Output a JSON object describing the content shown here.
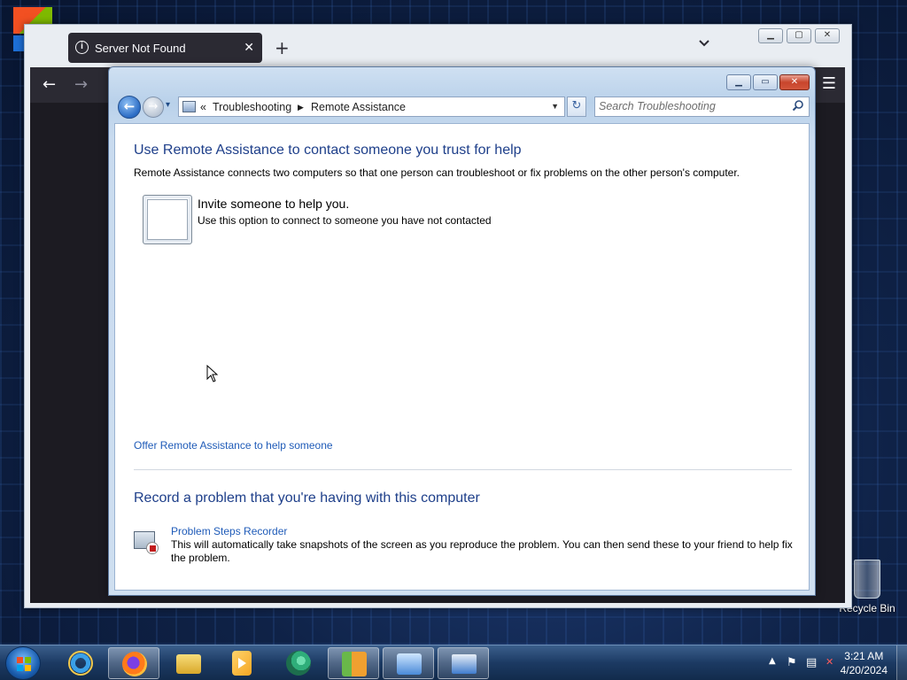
{
  "desktop": {
    "recycle_bin_label": "Recycle Bin"
  },
  "browser": {
    "tab_title": "Server Not Found",
    "tab_close": "✕",
    "new_tab": "+",
    "list_all_tabs": "⌄",
    "back": "←",
    "forward": "→",
    "menu": "☰",
    "window_controls": {
      "minimize": "▁",
      "maximize": "▢",
      "close": "✕"
    }
  },
  "dialog": {
    "window_controls": {
      "minimize": "▁",
      "maximize": "▭",
      "close": "✕"
    },
    "nav": {
      "back": "←",
      "forward": "→",
      "history_dropdown": "▾"
    },
    "address": {
      "overflow": "«",
      "crumb1": "Troubleshooting",
      "separator": "▶",
      "crumb2": "Remote Assistance",
      "dropdown": "▼"
    },
    "refresh": "↻",
    "search": {
      "placeholder": "Search Troubleshooting",
      "icon": "⚲"
    },
    "content": {
      "heading1": "Use Remote Assistance to contact someone you trust for help",
      "description": "Remote Assistance connects two computers so that one person can troubleshoot or fix problems on the other person's computer.",
      "invite_title": "Invite someone to help you.",
      "invite_desc": "Use this option to connect to someone you have not contacted",
      "offer_link": "Offer Remote Assistance to help someone",
      "heading2": "Record a problem that you're having with this computer",
      "psr_link": "Problem Steps Recorder",
      "psr_desc": "This will automatically take snapshots of the screen as you reproduce the problem. You can then send these to your friend to help fix the problem."
    }
  },
  "taskbar": {
    "items": [
      {
        "name": "internet-explorer",
        "color": "#3aa0e8"
      },
      {
        "name": "firefox",
        "color": "#ff7a1a"
      },
      {
        "name": "file-explorer",
        "color": "#f2c94c"
      },
      {
        "name": "media-player",
        "color": "#f5a623"
      },
      {
        "name": "browser-app",
        "color": "#2fae7a"
      },
      {
        "name": "control-panel-app",
        "color": "#f0a030"
      },
      {
        "name": "remote-desktop",
        "color": "#4a8ad8"
      },
      {
        "name": "display-app",
        "color": "#3f7ccd"
      }
    ],
    "tray": {
      "show_hidden": "▲",
      "flag": "⚑",
      "network": "▤",
      "volume": "✕"
    },
    "time": "3:21 AM",
    "date": "4/20/2024"
  }
}
